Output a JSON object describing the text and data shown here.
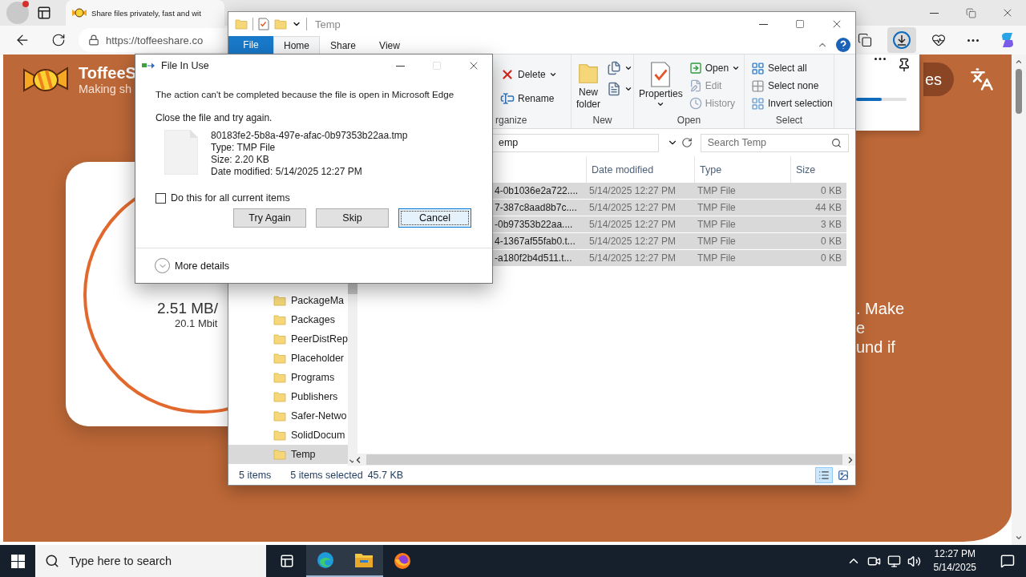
{
  "browser": {
    "tab_title": "Share files privately, fast and wit",
    "url": "https://toffeeshare.co",
    "page": {
      "brand": "ToffeeS",
      "tagline": "Making sh",
      "speed": "2.51 MB/",
      "bitrate": "20.1 Mbit",
      "pill": "es",
      "text_lines": [
        ". Make",
        "e",
        "und if"
      ]
    },
    "downloads": {
      "level": 0.5
    }
  },
  "explorer": {
    "title": "Temp",
    "tabs": [
      {
        "label": "File",
        "kind": "file",
        "selected": false
      },
      {
        "label": "Home",
        "kind": "tab",
        "selected": true
      },
      {
        "label": "Share",
        "kind": "tab",
        "selected": false
      },
      {
        "label": "View",
        "kind": "tab",
        "selected": false
      }
    ],
    "ribbon": [
      {
        "label": "rganize",
        "items": [
          {
            "kind": "small",
            "label": "Delete",
            "dropdown": true,
            "disabled": false
          },
          {
            "kind": "small",
            "label": "Rename",
            "dropdown": false,
            "disabled": false
          }
        ]
      },
      {
        "label": "New",
        "items": [
          {
            "kind": "large",
            "label": "New folder",
            "dropdown": false,
            "disabled": false
          },
          {
            "kind": "icon",
            "dropdown": true,
            "disabled": false
          },
          {
            "kind": "icon",
            "dropdown": true,
            "disabled": false
          }
        ]
      },
      {
        "label": "Open",
        "items": [
          {
            "kind": "large",
            "label": "Properties",
            "dropdown": true,
            "disabled": false
          },
          {
            "kind": "small",
            "label": "Open",
            "dropdown": true,
            "disabled": false
          },
          {
            "kind": "small",
            "label": "Edit",
            "dropdown": false,
            "disabled": true
          },
          {
            "kind": "small",
            "label": "History",
            "dropdown": false,
            "disabled": true
          }
        ]
      },
      {
        "label": "Select",
        "items": [
          {
            "kind": "small",
            "label": "Select all",
            "dropdown": false,
            "disabled": false
          },
          {
            "kind": "small",
            "label": "Select none",
            "dropdown": false,
            "disabled": false
          },
          {
            "kind": "small",
            "label": "Invert selection",
            "dropdown": false,
            "disabled": false
          }
        ]
      }
    ],
    "address": "emp",
    "search_placeholder": "Search Temp",
    "columns": [
      "Date modified",
      "Type",
      "Size"
    ],
    "rows": [
      {
        "name": "4-0b1036e2a722....",
        "date": "5/14/2025 12:27 PM",
        "type": "TMP File",
        "size": "0 KB",
        "selected": true
      },
      {
        "name": "7-387c8aad8b7c....",
        "date": "5/14/2025 12:27 PM",
        "type": "TMP File",
        "size": "44 KB",
        "selected": true
      },
      {
        "name": "-0b97353b22aa....",
        "date": "5/14/2025 12:27 PM",
        "type": "TMP File",
        "size": "3 KB",
        "selected": true
      },
      {
        "name": "4-1367af55fab0.t...",
        "date": "5/14/2025 12:27 PM",
        "type": "TMP File",
        "size": "0 KB",
        "selected": true
      },
      {
        "name": "-a180f2b4d511.t...",
        "date": "5/14/2025 12:27 PM",
        "type": "TMP File",
        "size": "0 KB",
        "selected": true
      }
    ],
    "nav": [
      {
        "label": "PackageMa",
        "selected": false
      },
      {
        "label": "Packages",
        "selected": false
      },
      {
        "label": "PeerDistRep",
        "selected": false
      },
      {
        "label": "Placeholder",
        "selected": false
      },
      {
        "label": "Programs",
        "selected": false
      },
      {
        "label": "Publishers",
        "selected": false
      },
      {
        "label": "Safer-Netwo",
        "selected": false
      },
      {
        "label": "SolidDocum",
        "selected": false
      },
      {
        "label": "Temp",
        "selected": true
      }
    ],
    "status": {
      "count": "5 items",
      "selected": "5 items selected",
      "size": "45.7 KB"
    },
    "views": [
      {
        "selected": true
      },
      {
        "selected": false
      }
    ]
  },
  "dialog": {
    "title": "File In Use",
    "message": "The action can't be completed because the file is open in Microsoft Edge",
    "instruction": "Close the file and try again.",
    "file": {
      "name": "80183fe2-5b8a-497e-afac-0b97353b22aa.tmp",
      "type": "Type: TMP File",
      "size": "Size: 2.20 KB",
      "modified": "Date modified: 5/14/2025 12:27 PM"
    },
    "apply_all": {
      "label": "Do this for all current items",
      "checked": false
    },
    "buttons": [
      {
        "label": "Try Again",
        "focused": false
      },
      {
        "label": "Skip",
        "focused": false
      },
      {
        "label": "Cancel",
        "focused": true
      }
    ],
    "details": "More details"
  },
  "taskbar": {
    "search_placeholder": "Type here to search",
    "time": "12:27 PM",
    "date": "5/14/2025"
  }
}
